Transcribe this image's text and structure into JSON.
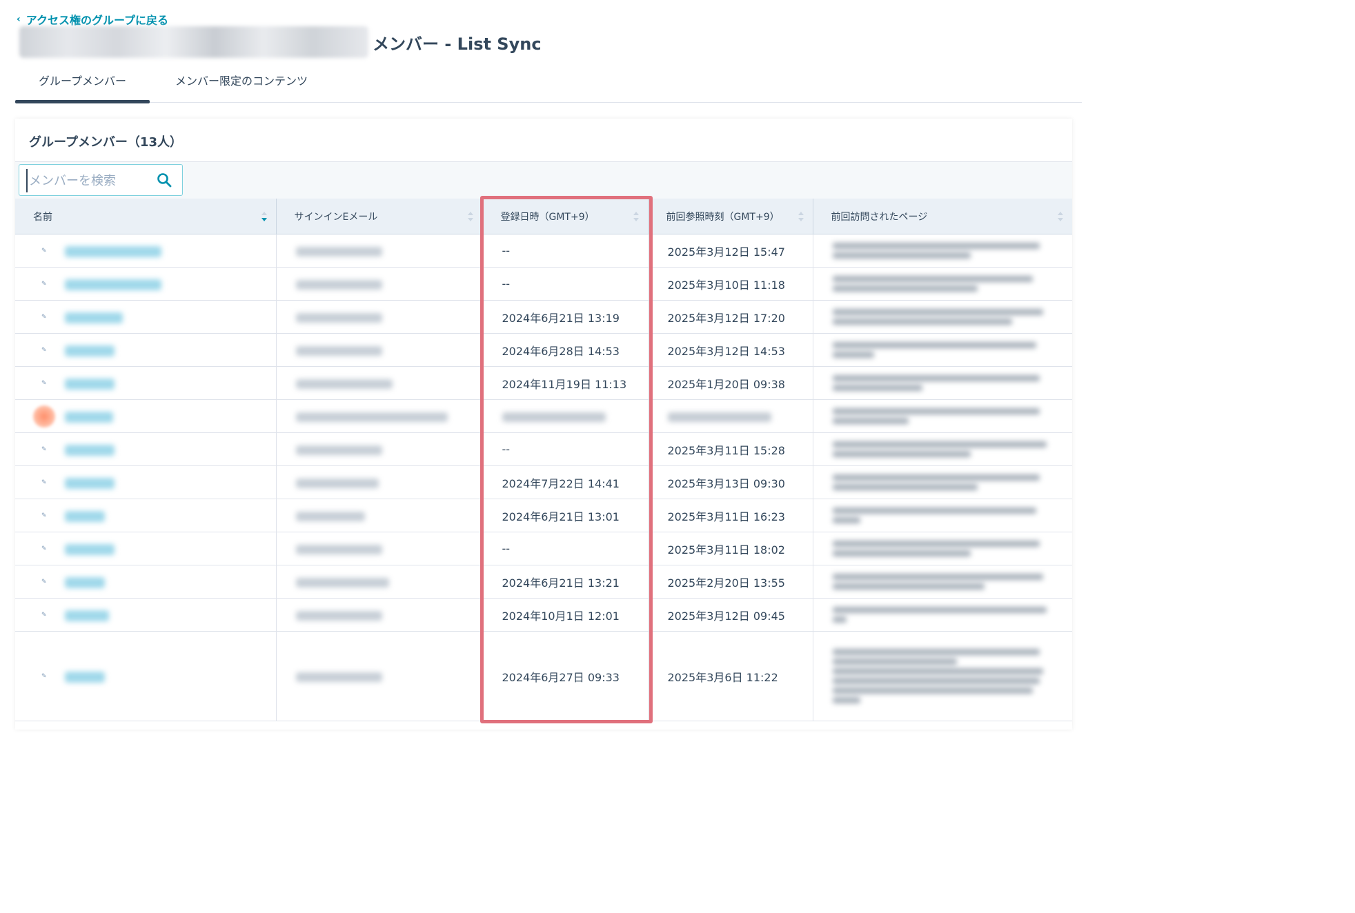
{
  "back_link": "アクセス権のグループに戻る",
  "page_title": "メンバー - List Sync",
  "tabs": [
    {
      "label": "グループメンバー",
      "active": true
    },
    {
      "label": "メンバー限定のコンテンツ",
      "active": false
    }
  ],
  "card": {
    "title": "グループメンバー（13人）",
    "search_placeholder": "メンバーを検索"
  },
  "table": {
    "columns": [
      "名前",
      "サインインEメール",
      "登録日時（GMT+9）",
      "前回参照時刻（GMT+9）",
      "前回訪問されたページ"
    ],
    "rows": [
      {
        "registered": "--",
        "last_viewed": "2025年3月12日 15:47"
      },
      {
        "registered": "--",
        "last_viewed": "2025年3月10日 11:18"
      },
      {
        "registered": "2024年6月21日 13:19",
        "last_viewed": "2025年3月12日 17:20"
      },
      {
        "registered": "2024年6月28日 14:53",
        "last_viewed": "2025年3月12日 14:53"
      },
      {
        "registered": "2024年11月19日 11:13",
        "last_viewed": "2025年1月20日 09:38"
      },
      {
        "registered": "",
        "last_viewed": ""
      },
      {
        "registered": "--",
        "last_viewed": "2025年3月11日 15:28"
      },
      {
        "registered": "2024年7月22日 14:41",
        "last_viewed": "2025年3月13日 09:30"
      },
      {
        "registered": "2024年6月21日 13:01",
        "last_viewed": "2025年3月11日 16:23"
      },
      {
        "registered": "--",
        "last_viewed": "2025年3月11日 18:02"
      },
      {
        "registered": "2024年6月21日 13:21",
        "last_viewed": "2025年2月20日 13:55"
      },
      {
        "registered": "2024年10月1日 12:01",
        "last_viewed": "2025年3月12日 09:45"
      },
      {
        "registered": "2024年6月27日 09:33",
        "last_viewed": "2025年3月6日 11:22"
      }
    ]
  },
  "colors": {
    "link": "#0091ae",
    "highlight": "#e0707c",
    "header_bg": "#eaf0f6",
    "text": "#33475b"
  }
}
